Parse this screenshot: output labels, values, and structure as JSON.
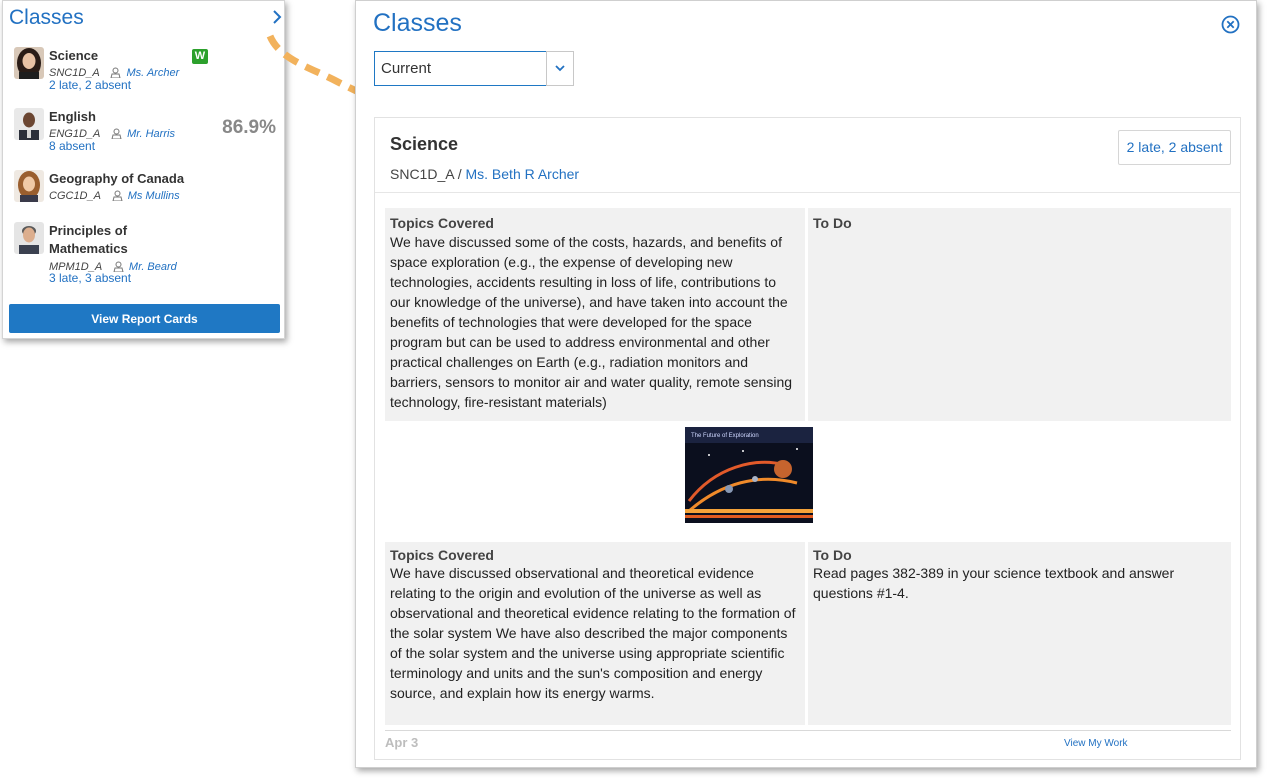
{
  "widget": {
    "title": "Classes",
    "classes": [
      {
        "name": "Science",
        "code": "SNC1D_A",
        "teacher": "Ms. Archer",
        "attendance": "2 late, 2 absent",
        "badge": "W"
      },
      {
        "name": "English",
        "code": "ENG1D_A",
        "teacher": "Mr. Harris",
        "attendance": "8 absent",
        "grade": "86.9%"
      },
      {
        "name": "Geography of Canada",
        "code": "CGC1D_A",
        "teacher": "Ms Mullins"
      },
      {
        "name_line1": "Principles of",
        "name_line2": "Mathematics",
        "code": "MPM1D_A",
        "teacher": "Mr. Beard",
        "attendance": "3 late, 3 absent"
      }
    ],
    "report_button": "View Report Cards"
  },
  "panel": {
    "title": "Classes",
    "filter": {
      "value": "Current"
    },
    "card": {
      "subject": "Science",
      "code": "SNC1D_A",
      "separator": "/",
      "teacher": "Ms. Beth R Archer",
      "attendance": "2 late, 2 absent",
      "lessons": [
        {
          "topics_label": "Topics Covered",
          "topics": "We have discussed some of the costs, hazards, and benefits of space exploration (e.g., the expense of developing new technologies, accidents resulting in loss of life, contributions to our knowledge of the universe), and have taken into account the benefits of technologies that were developed for the space program but can be used to address environmental and other practical challenges on Earth (e.g., radiation monitors and barriers, sensors to monitor air and water quality, remote sensing technology, fire-resistant materials)",
          "todo_label": "To Do",
          "todo": ""
        },
        {
          "topics_label": "Topics Covered",
          "topics": "We have discussed observational and theoretical evidence relating to the origin and evolution of the universe as well as observational and theoretical evidence relating to the formation of the solar system We have also described the major components of the solar system and the universe using appropriate scientific terminology and units and the sun's composition and energy source, and explain how its energy warms.",
          "todo_label": "To Do",
          "todo": "Read pages 382-389 in your science textbook and answer questions #1-4."
        }
      ],
      "image_caption": "The Future of Exploration",
      "footer_date": "Apr 3",
      "view_work": "View My Work"
    }
  },
  "colors": {
    "accent": "#2271c2",
    "button": "#1f78c4",
    "badge": "#2ca02c",
    "arrow": "#f2b25c"
  },
  "icons": [
    "chevron-right-icon",
    "teacher-icon",
    "close-circle-icon",
    "chevron-down-icon",
    "dashed-arrow"
  ]
}
